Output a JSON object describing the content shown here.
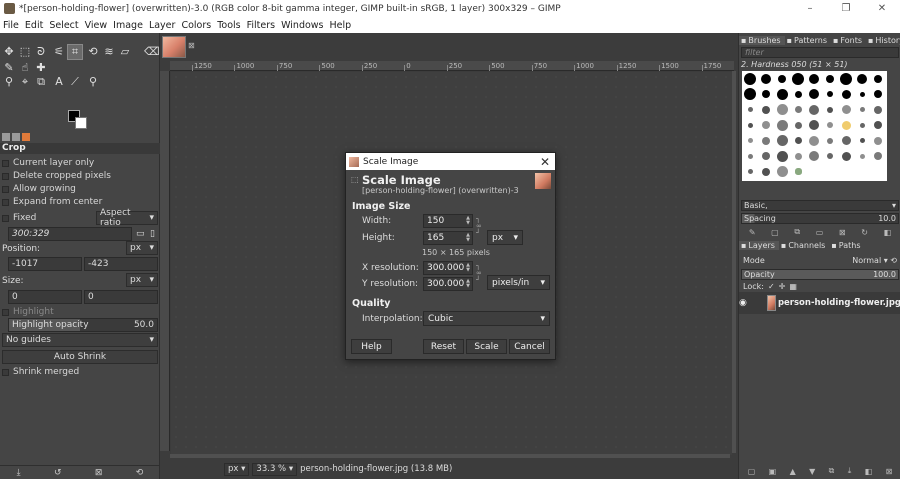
{
  "window": {
    "title": "*[person-holding-flower] (overwritten)-3.0 (RGB color 8-bit gamma integer, GIMP built-in sRGB, 1 layer) 300x329 – GIMP"
  },
  "menu": [
    "File",
    "Edit",
    "Select",
    "View",
    "Image",
    "Layer",
    "Colors",
    "Tools",
    "Filters",
    "Windows",
    "Help"
  ],
  "tool_options": {
    "title": "Crop",
    "current_layer_only": "Current layer only",
    "delete_cropped": "Delete cropped pixels",
    "allow_growing": "Allow growing",
    "expand_from_center": "Expand from center",
    "fixed": "Fixed",
    "aspect_ratio": "Aspect ratio",
    "ratio_value": "300:329",
    "position_label": "Position:",
    "position_unit": "px",
    "position_x": "-1017",
    "position_y": "-423",
    "size_label": "Size:",
    "size_unit": "px",
    "size_w": "0",
    "size_h": "0",
    "highlight": "Highlight",
    "highlight_opacity_label": "Highlight opacity",
    "highlight_opacity_value": "50.0",
    "guides": "No guides",
    "auto_shrink": "Auto Shrink",
    "shrink_merged": "Shrink merged"
  },
  "ruler": {
    "ticks": [
      "1250",
      "1000",
      "750",
      "500",
      "250",
      "0",
      "250",
      "500",
      "750",
      "1000",
      "1250",
      "1500",
      "1750"
    ]
  },
  "status": {
    "unit": "px",
    "zoom": "33.3 %",
    "info": "person-holding-flower.jpg (13.8 MB)"
  },
  "dialog": {
    "title": "Scale Image",
    "heading": "Scale Image",
    "subheading": "[person-holding-flower] (overwritten)-3",
    "image_size_label": "Image Size",
    "width_label": "Width:",
    "width_value": "150",
    "height_label": "Height:",
    "height_value": "165",
    "size_unit": "px",
    "size_info": "150 × 165 pixels",
    "xres_label": "X resolution:",
    "xres_value": "300.000",
    "yres_label": "Y resolution:",
    "yres_value": "300.000",
    "res_unit": "pixels/in",
    "quality_label": "Quality",
    "interp_label": "Interpolation:",
    "interp_value": "Cubic",
    "help": "Help",
    "reset": "Reset",
    "scale": "Scale",
    "cancel": "Cancel"
  },
  "dock": {
    "tabs": [
      "Brushes",
      "Patterns",
      "Fonts",
      "History"
    ],
    "filter_placeholder": "filter",
    "brush_name": "2. Hardness 050 (51 × 51)",
    "preset": "Basic,",
    "spacing_label": "Spacing",
    "spacing_value": "10.0",
    "layer_tabs": [
      "Layers",
      "Channels",
      "Paths"
    ],
    "mode_label": "Mode",
    "mode_value": "Normal",
    "opacity_label": "Opacity",
    "opacity_value": "100.0",
    "lock_label": "Lock:",
    "layer_name": "person-holding-flower.jpg"
  }
}
